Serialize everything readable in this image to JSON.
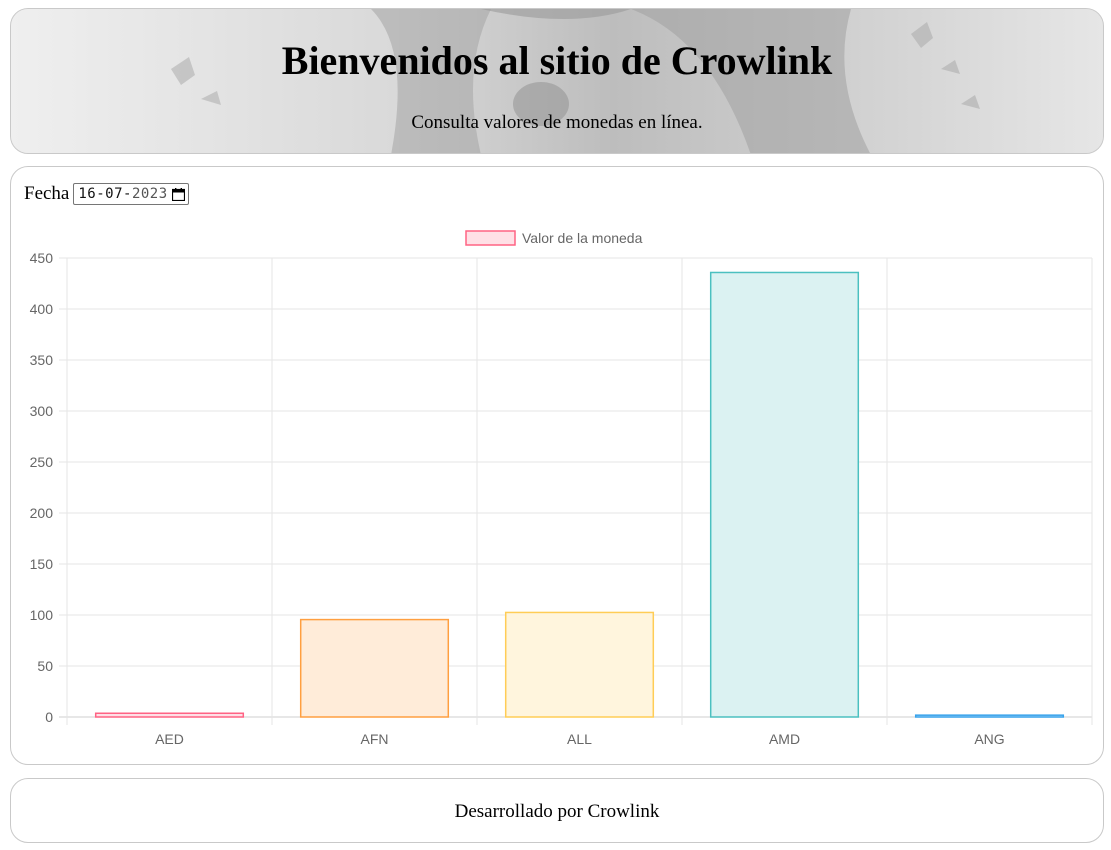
{
  "header": {
    "title": "Bienvenidos al sitio de Crowlink",
    "subtitle": "Consulta valores de monedas en línea."
  },
  "form": {
    "date_label": "Fecha",
    "date_day_month": "16-07-",
    "date_year": "2023",
    "date_icon": "calendar-icon"
  },
  "chart_data": {
    "type": "bar",
    "categories": [
      "AED",
      "AFN",
      "ALL",
      "AMD",
      "ANG"
    ],
    "series": [
      {
        "name": "Valor de la moneda",
        "values": [
          3.67,
          95.5,
          102.5,
          435.8,
          1.8
        ]
      }
    ],
    "ylim": [
      0,
      450
    ],
    "yticks": [
      0,
      50,
      100,
      150,
      200,
      250,
      300,
      350,
      400,
      450
    ],
    "grid": true,
    "legend": "top-center",
    "bar_fills": [
      "#ffe0e6",
      "#ffecd9",
      "#fff5dd",
      "#dbf2f2",
      "#d7ecfb"
    ],
    "bar_borders": [
      "#ff6384",
      "#ff9f40",
      "#ffcd56",
      "#4bc0c0",
      "#36a2eb"
    ],
    "legend_fill": "#ffe0e6",
    "legend_border": "#ff6384"
  },
  "footer": {
    "text": "Desarrollado por Crowlink"
  }
}
